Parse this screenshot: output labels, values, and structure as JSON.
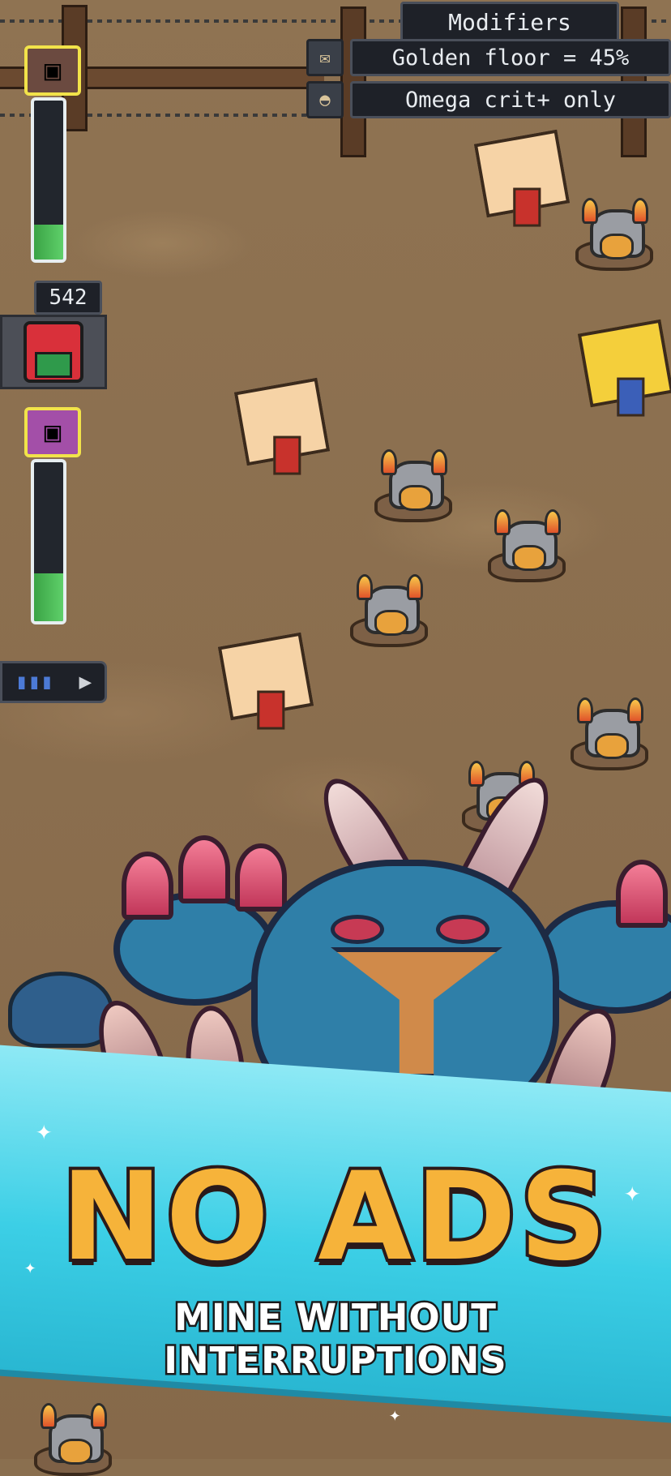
{
  "modifiers": {
    "title": "Modifiers",
    "rows": [
      {
        "label": "Golden floor = 45%",
        "icon": "scroll-icon"
      },
      {
        "label": "Omega crit+ only",
        "icon": "mole-icon"
      }
    ]
  },
  "hud": {
    "top_bar_level": 0.22,
    "bottom_bar_level": 0.3,
    "gift_count": "542",
    "speed_button": {
      "left_icon": "bars-icon",
      "right_icon": "play-icon"
    }
  },
  "banner": {
    "title": "NO ADS",
    "subtitle": "MINE WITHOUT INTERRUPTIONS"
  },
  "colors": {
    "banner_title": "#f6b33a",
    "banner_bg": "#3ccfe6",
    "bar_fill": "#4cbf58"
  }
}
